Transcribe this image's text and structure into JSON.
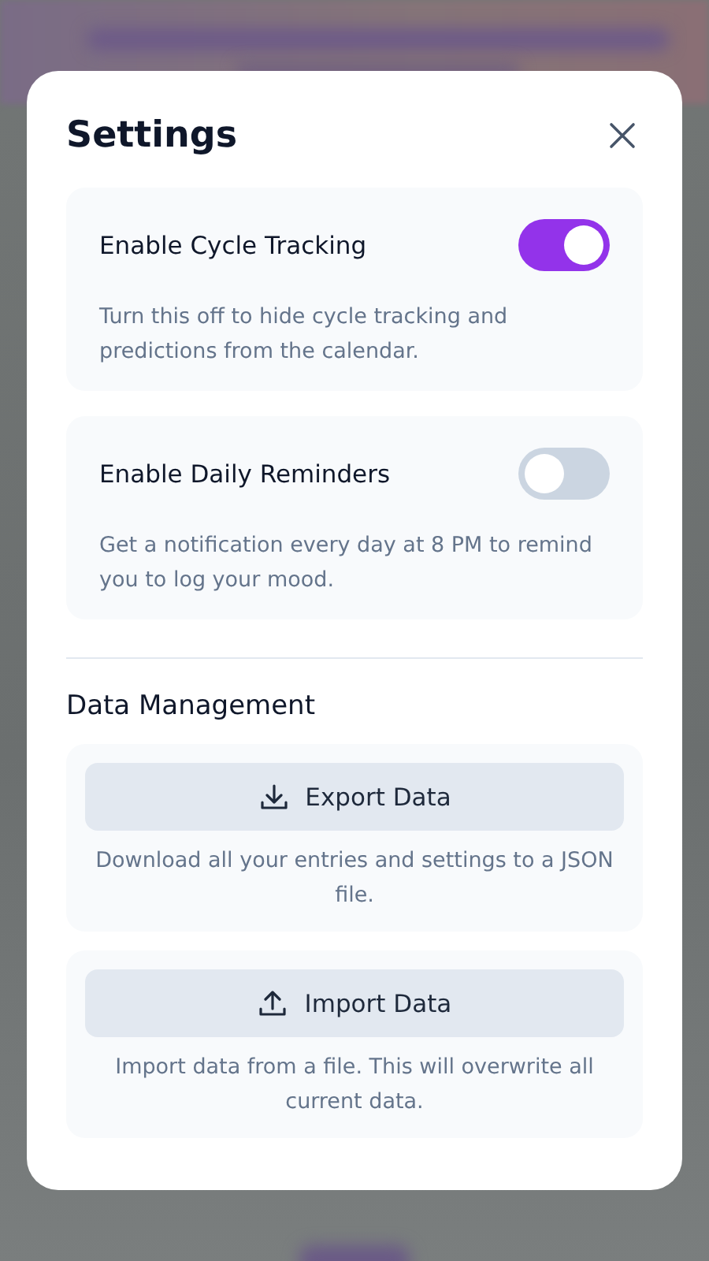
{
  "dialog": {
    "title": "Settings"
  },
  "toggles": [
    {
      "label": "Enable Cycle Tracking",
      "on": true,
      "description": "Turn this off to hide cycle tracking and predictions from the calendar."
    },
    {
      "label": "Enable Daily Reminders",
      "on": false,
      "description": "Get a notification every day at 8 PM to remind you to log your mood."
    }
  ],
  "data_management": {
    "heading": "Data Management",
    "actions": [
      {
        "kind": "export",
        "label": "Export Data",
        "description": "Download all your entries and settings to a JSON file."
      },
      {
        "kind": "import",
        "label": "Import Data",
        "description": "Import data from a file. This will overwrite all current data."
      }
    ]
  }
}
